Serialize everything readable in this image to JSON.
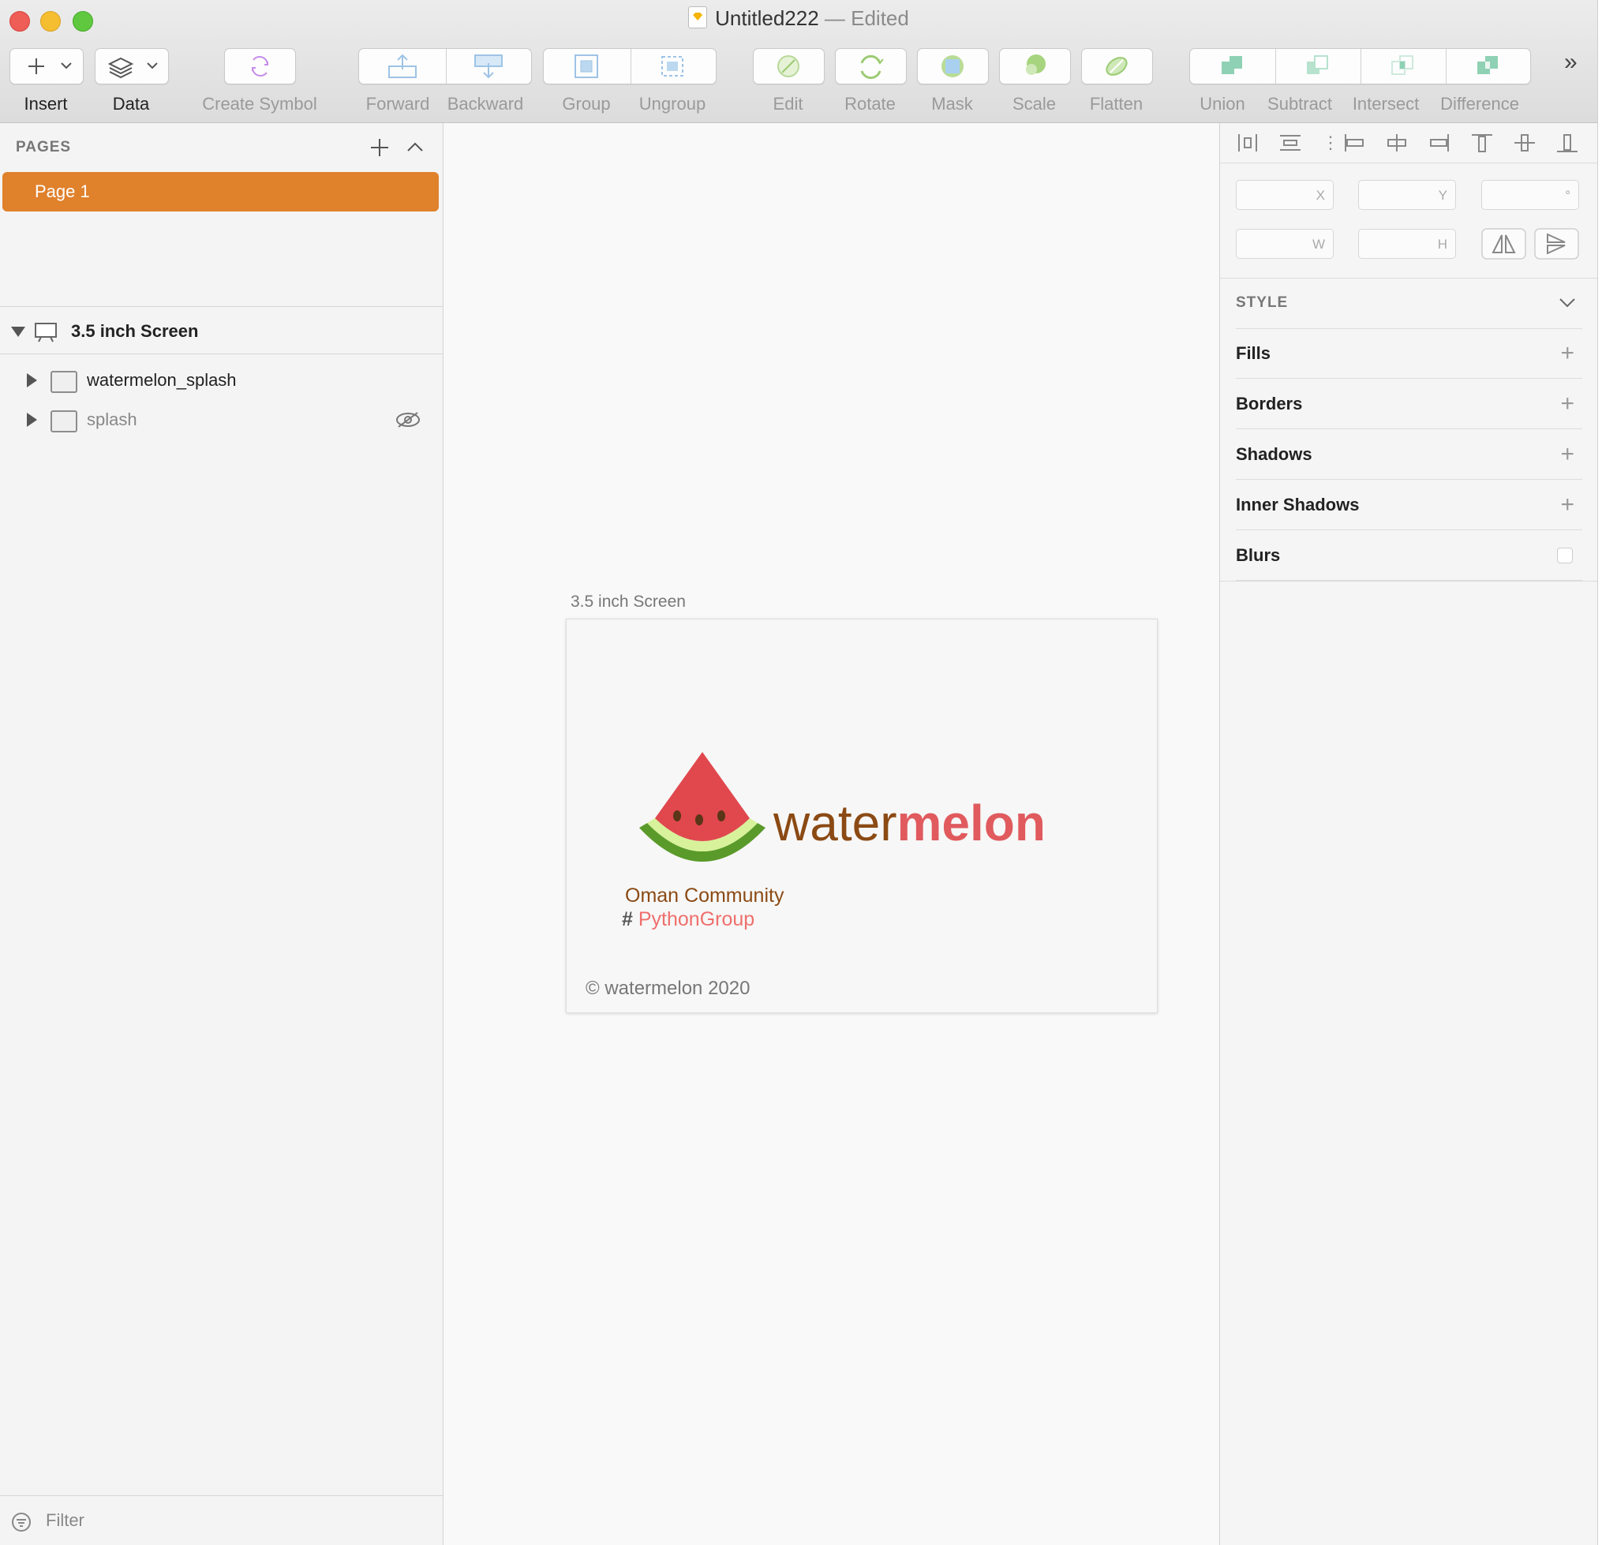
{
  "window": {
    "title": "Untitled222",
    "status": "— Edited"
  },
  "toolbar": {
    "insert": "Insert",
    "data": "Data",
    "create_symbol": "Create Symbol",
    "forward": "Forward",
    "backward": "Backward",
    "group": "Group",
    "ungroup": "Ungroup",
    "edit": "Edit",
    "rotate": "Rotate",
    "mask": "Mask",
    "scale": "Scale",
    "flatten": "Flatten",
    "union": "Union",
    "subtract": "Subtract",
    "intersect": "Intersect",
    "difference": "Difference",
    "more": "»"
  },
  "sidebar": {
    "pages_header": "PAGES",
    "pages": [
      {
        "label": "Page 1",
        "selected": true
      }
    ],
    "artboard": "3.5 inch Screen",
    "layers": [
      {
        "label": "watermelon_splash",
        "hidden": false
      },
      {
        "label": "splash",
        "hidden": true
      }
    ],
    "filter_placeholder": "Filter"
  },
  "canvas": {
    "artboard_label": "3.5 inch Screen",
    "logo_word_light": "water",
    "logo_word_bold": "melon",
    "subtitle": "Oman Community",
    "hash": "#",
    "hashtag": "PythonGroup",
    "copyright": "© watermelon 2020"
  },
  "inspector": {
    "x_label": "X",
    "y_label": "Y",
    "rot_label": "°",
    "w_label": "W",
    "h_label": "H",
    "style_header": "STYLE",
    "sections": [
      "Fills",
      "Borders",
      "Shadows",
      "Inner Shadows",
      "Blurs"
    ]
  },
  "colors": {
    "accent": "#e0812c",
    "logo_brown": "#8b4a14",
    "logo_red": "#e05a5e",
    "pink": "#ef6f6c"
  }
}
